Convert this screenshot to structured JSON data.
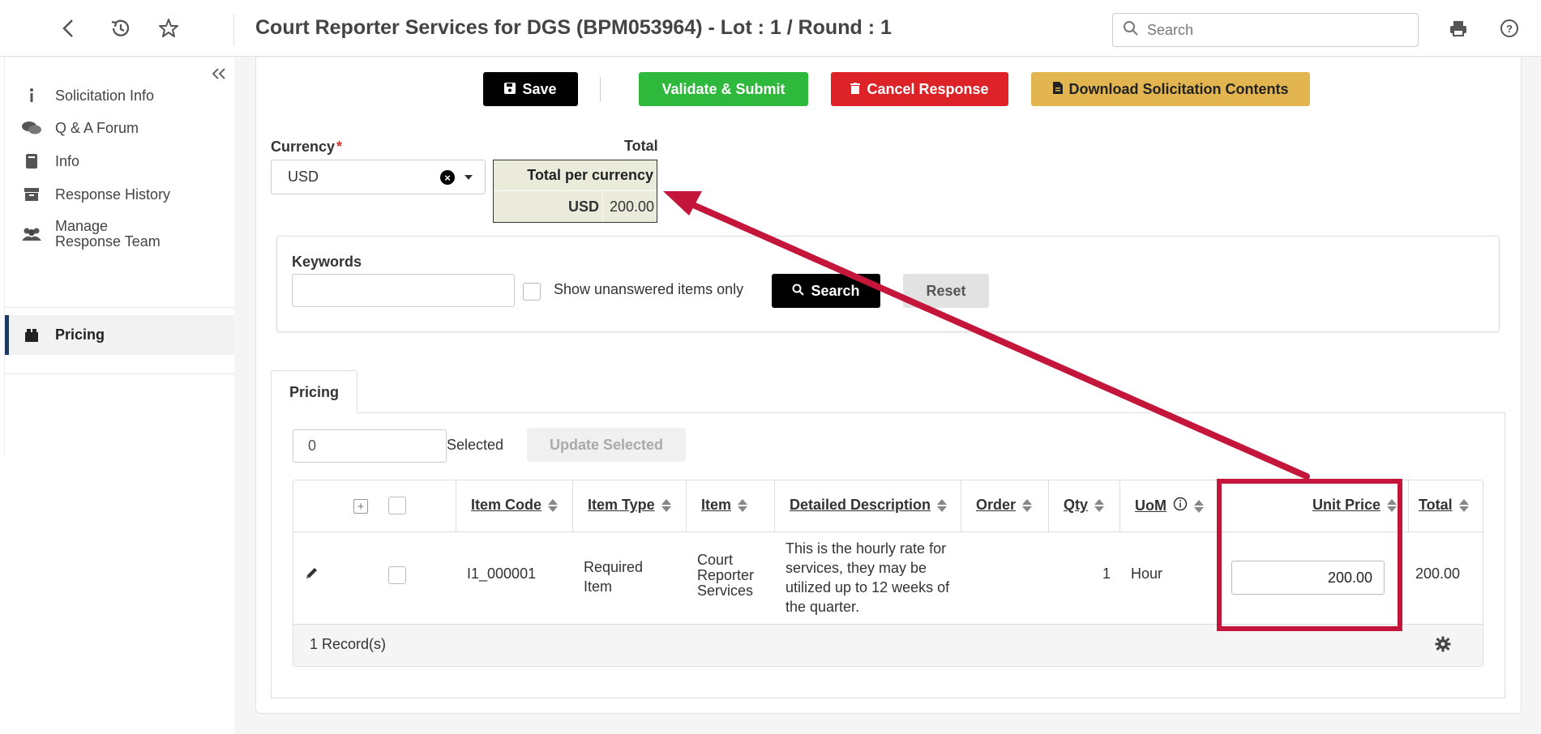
{
  "header": {
    "title": "Court Reporter Services for DGS (BPM053964) - Lot : 1 / Round : 1",
    "search_placeholder": "Search"
  },
  "sidebar": {
    "items": [
      {
        "label": "Solicitation Info",
        "icon": "info-icon"
      },
      {
        "label": "Q & A Forum",
        "icon": "comments-icon"
      },
      {
        "label": "Info",
        "icon": "book-icon"
      },
      {
        "label": "Response History",
        "icon": "archive-icon"
      },
      {
        "label": "Manage Response Team",
        "icon": "users-icon"
      },
      {
        "label": "Pricing",
        "icon": "box-icon",
        "active": true
      }
    ]
  },
  "toolbar": {
    "save": "Save",
    "validate": "Validate & Submit",
    "cancel": "Cancel Response",
    "download": "Download Solicitation Contents"
  },
  "currency": {
    "label": "Currency",
    "value": "USD"
  },
  "totals": {
    "heading": "Total",
    "per_currency": "Total per currency",
    "currency": "USD",
    "amount": "200.00"
  },
  "filter": {
    "keywords_label": "Keywords",
    "keywords_value": "",
    "unanswered_label": "Show unanswered items only",
    "search": "Search",
    "reset": "Reset"
  },
  "tabs": [
    {
      "label": "Pricing"
    }
  ],
  "bulk": {
    "selected_count": "0",
    "selected_label": "Selected",
    "update_selected": "Update Selected"
  },
  "grid": {
    "columns": [
      "Item Code",
      "Item Type",
      "Item",
      "Detailed Description",
      "Order",
      "Qty",
      "UoM",
      "Unit Price",
      "Total"
    ],
    "row": {
      "item_code": "I1_000001",
      "item_type": "Required Item",
      "item": "Court Reporter Services",
      "description": "This is the hourly rate for services, they may be utilized up to 12 weeks of the quarter.",
      "order": "",
      "qty": "1",
      "uom": "Hour",
      "unit_price": "200.00",
      "total": "200.00"
    },
    "record_count": "1 Record(s)"
  },
  "colors": {
    "annotation": "#c3163a",
    "save": "#000000",
    "validate": "#2eb83c",
    "cancel": "#dd2228",
    "download": "#e2b550",
    "link": "#1a6fc2"
  }
}
